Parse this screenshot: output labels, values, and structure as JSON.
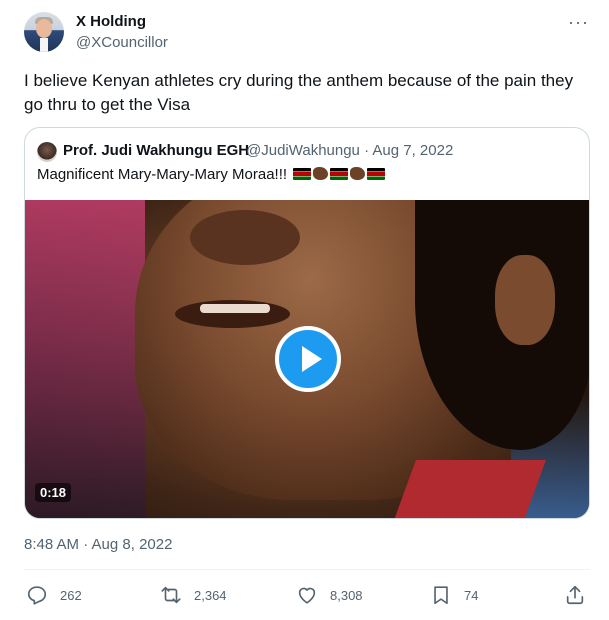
{
  "author": {
    "display_name": "X Holding",
    "handle": "@XCouncillor"
  },
  "more_icon": "···",
  "tweet_text": "I believe Kenyan athletes cry during the anthem because of the pain they go thru to get the Visa",
  "quoted": {
    "display_name": "Prof. Judi Wakhungu EGH",
    "handle_and_date": "@JudiWakhungu · Aug 7, 2022",
    "text": "Magnificent Mary-Mary-Mary Moraa!!!",
    "emojis": [
      "kenya-flag",
      "clapping-hands",
      "kenya-flag",
      "clapping-hands",
      "kenya-flag"
    ],
    "video_duration": "0:18"
  },
  "timestamp": "8:48 AM · Aug 8, 2022",
  "stats": {
    "replies": "262",
    "retweets": "2,364",
    "likes": "8,308",
    "bookmarks": "74"
  },
  "colors": {
    "accent": "#1d9bf0",
    "secondary_text": "#536471",
    "border": "#cfd9de"
  }
}
